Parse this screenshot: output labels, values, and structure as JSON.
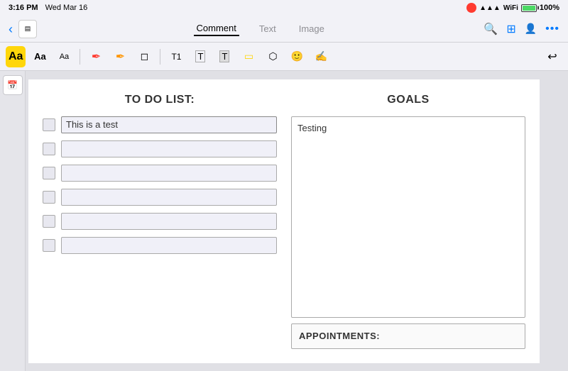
{
  "statusBar": {
    "time": "3:16 PM",
    "date": "Wed Mar 16",
    "batteryPct": "100%",
    "recording": true
  },
  "navBar": {
    "backLabel": "‹",
    "tabs": [
      {
        "label": "Comment",
        "active": true
      },
      {
        "label": "Text",
        "active": false
      },
      {
        "label": "Image",
        "active": false
      }
    ],
    "icons": {
      "search": "🔍",
      "grid": "⊞",
      "person": "👤",
      "more": "···"
    }
  },
  "toolbar": {
    "buttons": [
      {
        "id": "font-bold",
        "label": "Aa",
        "active": true
      },
      {
        "id": "font-med",
        "label": "Aa",
        "active": false
      },
      {
        "id": "font-small",
        "label": "Aa",
        "active": false
      },
      {
        "id": "pen-red",
        "label": "✏",
        "color": "red"
      },
      {
        "id": "pen-orange",
        "label": "✏",
        "color": "orange"
      },
      {
        "id": "eraser",
        "label": "◻"
      },
      {
        "id": "text-T1",
        "label": "T1"
      },
      {
        "id": "text-T2",
        "label": "T"
      },
      {
        "id": "text-T3",
        "label": "T"
      },
      {
        "id": "highlight",
        "label": "▭"
      },
      {
        "id": "shape",
        "label": "○"
      },
      {
        "id": "person",
        "label": "🙂"
      },
      {
        "id": "sign",
        "label": "✍"
      }
    ],
    "undoLabel": "↩"
  },
  "thumbPanel": {
    "icon": "≡"
  },
  "todoSection": {
    "title": "TO DO LIST:",
    "items": [
      {
        "text": "This is a test",
        "hasCursor": true
      },
      {
        "text": "",
        "hasCursor": false
      },
      {
        "text": "",
        "hasCursor": false
      },
      {
        "text": "",
        "hasCursor": false
      },
      {
        "text": "",
        "hasCursor": false
      },
      {
        "text": "",
        "hasCursor": false
      }
    ]
  },
  "goalsSection": {
    "title": "GOALS",
    "text": "Testing"
  },
  "appointmentsSection": {
    "title": "APPOINTMENTS:"
  }
}
